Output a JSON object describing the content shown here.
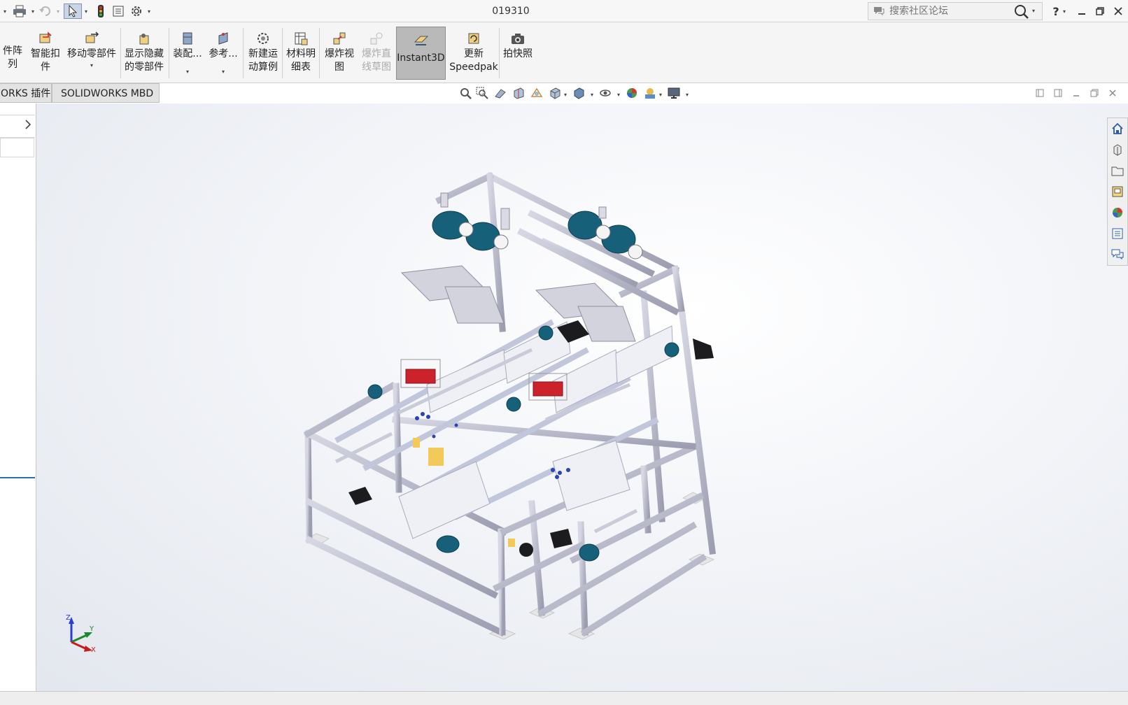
{
  "titlebar": {
    "title": "019310",
    "search_placeholder": "搜索社区论坛",
    "help_label": "?"
  },
  "ribbon": {
    "items": [
      {
        "label": "件阵列"
      },
      {
        "label": "智能扣\n件"
      },
      {
        "label": "移动零部件"
      },
      {
        "label": "显示隐藏\n的零部件"
      },
      {
        "label": "装配..."
      },
      {
        "label": "参考..."
      },
      {
        "label": "新建运\n动算例"
      },
      {
        "label": "材料明\n细表"
      },
      {
        "label": "爆炸视\n图"
      },
      {
        "label": "爆炸直\n线草图"
      },
      {
        "label": "Instant3D"
      },
      {
        "label": "更新\nSpeedpak"
      },
      {
        "label": "拍快照"
      }
    ]
  },
  "tabs": [
    {
      "label": "ORKS 插件"
    },
    {
      "label": "SOLIDWORKS MBD"
    }
  ],
  "triad": {
    "x": "X",
    "y": "Y",
    "z": "Z"
  },
  "colors": {
    "frame": "#b7b8c8",
    "motor_teal": "#17607a",
    "accent_red": "#c8202a",
    "ribbon_bg": "#f5f5f5",
    "active_button": "#b9b9b9"
  },
  "icons": {
    "taskpane": [
      "home-icon",
      "parts-library-icon",
      "file-explorer-icon",
      "view-palette-icon",
      "appearances-icon",
      "custom-properties-icon",
      "forum-icon"
    ]
  }
}
